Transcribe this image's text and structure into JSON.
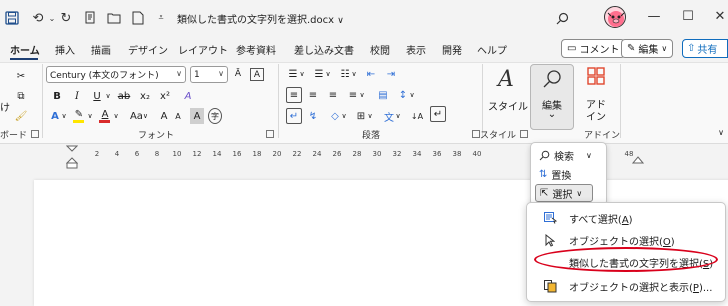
{
  "titlebar": {
    "doc_title": "類似した書式の文字列を選択.docx",
    "title_chevron": "∨"
  },
  "tabs": [
    {
      "label": "ホーム",
      "active": true
    },
    {
      "label": "挿入"
    },
    {
      "label": "描画"
    },
    {
      "label": "デザイン"
    },
    {
      "label": "レイアウト"
    },
    {
      "label": "参考資料"
    },
    {
      "label": "差し込み文書"
    },
    {
      "label": "校閲"
    },
    {
      "label": "表示"
    },
    {
      "label": "開発"
    },
    {
      "label": "ヘルプ"
    }
  ],
  "right_buttons": {
    "comment": "コメント",
    "edit": "編集",
    "edit_chevron": "∨",
    "share": "共有"
  },
  "ribbon": {
    "clipboard": {
      "label": "ボード",
      "paste_fragment": "け"
    },
    "font": {
      "label": "フォント",
      "font_name": "Century (本文のフォント)",
      "font_size": "1",
      "bold": "B",
      "italic": "I",
      "underline": "U",
      "strike": "ab",
      "subscript": "x₂",
      "superscript": "x²",
      "case": "Aa",
      "grow": "A",
      "shrink": "A",
      "boxed": "A",
      "circled": "字",
      "highlight_color": "#ffe600",
      "font_color": "#d92b2b"
    },
    "paragraph": {
      "label": "段落"
    },
    "styles": {
      "label": "スタイル",
      "button": "スタイル"
    },
    "editing": {
      "button": "編集",
      "chevron": "⌄"
    },
    "designer": {
      "label": "アドイン",
      "button_line1": "アド",
      "button_line2": "イン"
    }
  },
  "ruler": {
    "numbers": [
      "2",
      "4",
      "6",
      "8",
      "10",
      "12",
      "14",
      "16",
      "18",
      "20",
      "22",
      "24",
      "26",
      "28",
      "30",
      "32",
      "34",
      "36",
      "38",
      "40",
      "48"
    ]
  },
  "edit_menu": {
    "search": "検索",
    "search_chevron": "∨",
    "replace": "置換",
    "select": "選択",
    "select_chevron": "∨"
  },
  "select_submenu": {
    "items": [
      {
        "text": "すべて選択(",
        "key": "A",
        "close": ")"
      },
      {
        "text": "オブジェクトの選択(",
        "key": "O",
        "close": ")"
      },
      {
        "text": "類似した書式の文字列を選択(",
        "key": "S",
        "close": ")"
      },
      {
        "text": "オブジェクトの選択と表示(",
        "key": "P",
        "close": ")..."
      }
    ]
  },
  "colors": {
    "accent": "#0f6cbd",
    "tab_underline": "#1d3f73",
    "highlight_oval": "#d9001b",
    "designer_icon": "#e0462e"
  }
}
